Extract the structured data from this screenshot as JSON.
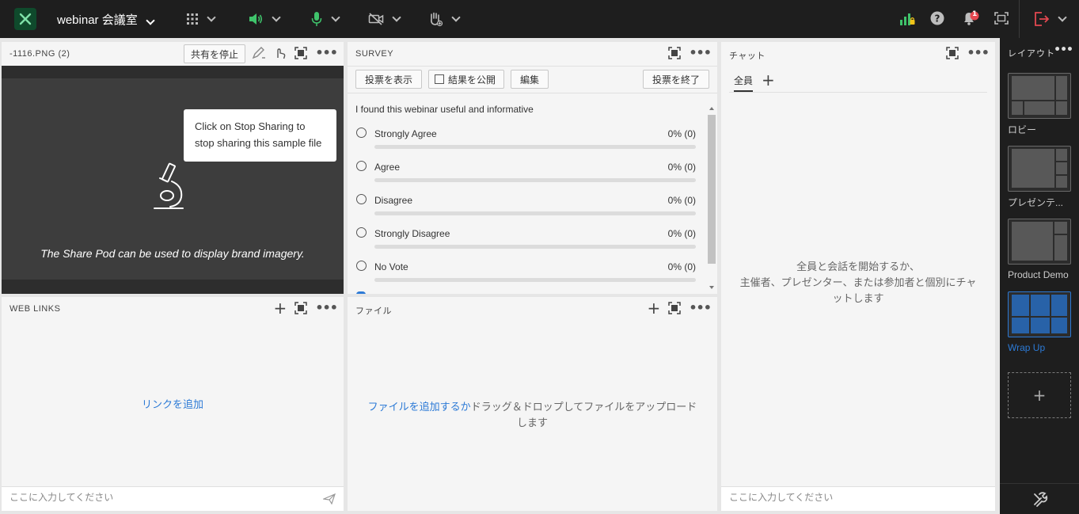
{
  "topbar": {
    "room_title": "webinar 会議室",
    "notification_count": "1"
  },
  "share_pod": {
    "title": "-1116.PNG (2)",
    "stop_sharing_label": "共有を停止",
    "tooltip_text": "Click on Stop Sharing to stop sharing this sample file",
    "caption": "The Share Pod can be used to display brand imagery."
  },
  "survey": {
    "title": "SURVEY",
    "buttons": {
      "show_votes": "投票を表示",
      "publish_results": "結果を公開",
      "edit": "編集",
      "end_poll": "投票を終了"
    },
    "question": "I found this webinar useful and informative",
    "options": [
      {
        "label": "Strongly Agree",
        "result": "0% (0)",
        "fraction": 0
      },
      {
        "label": "Agree",
        "result": "0% (0)",
        "fraction": 0
      },
      {
        "label": "Disagree",
        "result": "0% (0)",
        "fraction": 0
      },
      {
        "label": "Strongly Disagree",
        "result": "0% (0)",
        "fraction": 0
      },
      {
        "label": "No Vote",
        "result": "0% (0)",
        "fraction": 0
      }
    ]
  },
  "chat": {
    "title": "チャット",
    "tab_all": "全員",
    "empty_message_line1": "全員と会話を開始するか、",
    "empty_message_line2": "主催者、プレゼンター、または参加者と個別にチャ",
    "empty_message_line3": "ットします",
    "input_placeholder": "ここに入力してください"
  },
  "weblinks": {
    "title": "WEB LINKS",
    "add_link": "リンクを追加",
    "input_placeholder": "ここに入力してください"
  },
  "files": {
    "title": "ファイル",
    "add_file_link": "ファイルを追加するか",
    "drop_text_1": "ドラッグ＆ドロップしてファイルをアップロード",
    "drop_text_2": "します"
  },
  "layouts": {
    "title": "レイアウト",
    "items": [
      {
        "label": "ロビー",
        "active": false
      },
      {
        "label": "プレゼンテ...",
        "active": false
      },
      {
        "label": "Product Demo",
        "active": false
      },
      {
        "label": "Wrap Up",
        "active": true
      }
    ],
    "accent_color": "#2c7ad6"
  },
  "icons": [
    "app-logo-icon",
    "apps-grid-icon",
    "speaker-icon",
    "microphone-icon",
    "camera-off-icon",
    "raise-hand-icon",
    "signal-bars-icon",
    "help-icon",
    "bell-icon",
    "fullscreen-icon",
    "exit-icon",
    "pen-icon",
    "pointer-icon",
    "maximize-icon",
    "more-icon",
    "plus-icon",
    "send-icon",
    "microscope-icon",
    "tools-icon"
  ]
}
